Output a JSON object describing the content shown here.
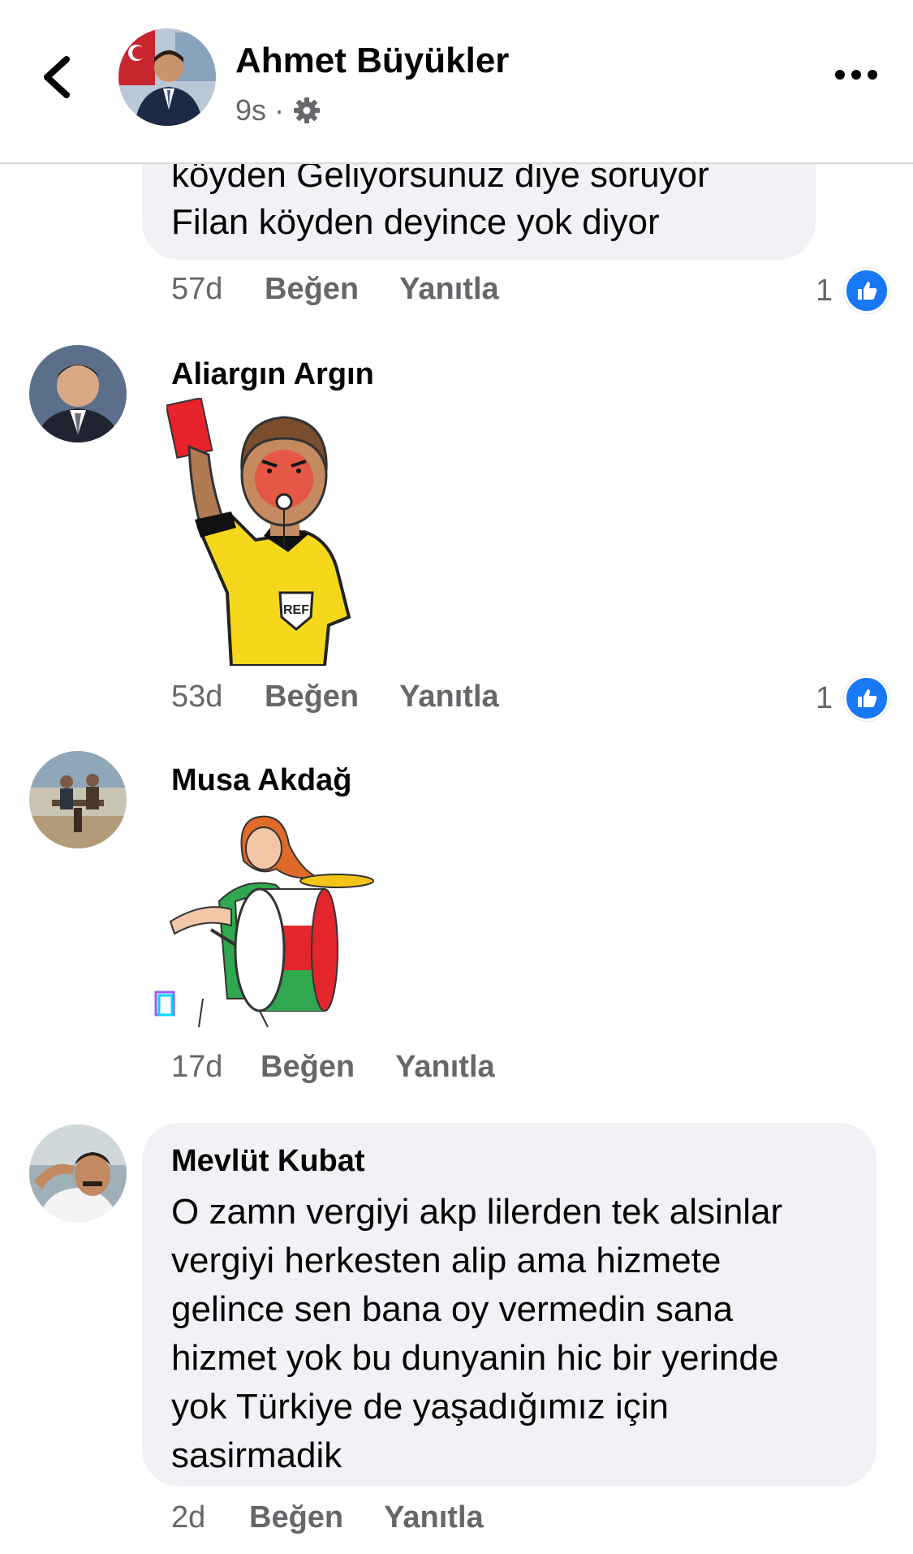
{
  "header": {
    "name": "Ahmet Büyükler",
    "time": "9s",
    "separator": "·"
  },
  "comments": [
    {
      "text_line1": "köyden Geliyorsunuz diye soruyor",
      "text_line2": "Filan köyden deyince yok diyor",
      "time": "57d",
      "like_label": "Beğen",
      "reply_label": "Yanıtla",
      "reactions": "1"
    },
    {
      "author": "Aliargın Argın",
      "sticker": "referee-red-card-sticker",
      "sticker_text": "REF",
      "time": "53d",
      "like_label": "Beğen",
      "reply_label": "Yanıtla",
      "reactions": "1"
    },
    {
      "author": "Musa Akdağ",
      "sticker": "drummer-girl-sticker",
      "time": "17d",
      "like_label": "Beğen",
      "reply_label": "Yanıtla"
    },
    {
      "author": "Mevlüt Kubat",
      "lines": [
        "O zamn vergiyi akp lilerden tek alsinlar",
        "vergiyi herkesten alip ama hizmete",
        "gelince sen bana oy vermedin sana",
        "hizmet yok bu dunyanin hic bir yerinde",
        "yok Türkiye de yaşadığımız için",
        "sasirmadik"
      ],
      "time": "2d",
      "like_label": "Beğen",
      "reply_label": "Yanıtla"
    }
  ],
  "colors": {
    "bubble": "#f0f2f5",
    "meta": "#65676b",
    "like_blue": "#1877f2"
  }
}
